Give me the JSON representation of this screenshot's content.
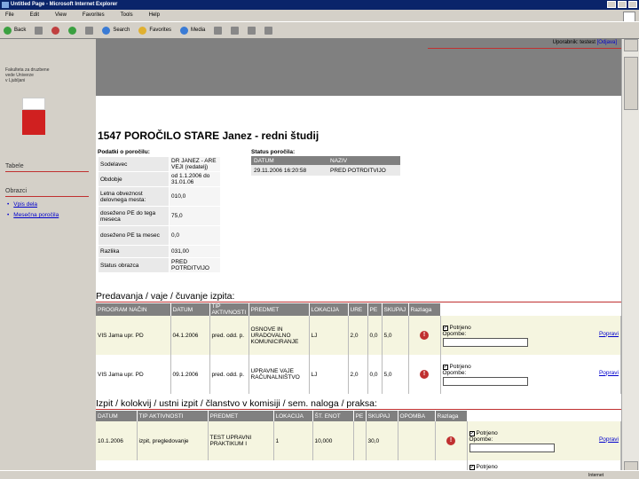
{
  "window": {
    "title": "Untitled Page - Microsoft Internet Explorer"
  },
  "menu": [
    "File",
    "Edit",
    "View",
    "Favorites",
    "Tools",
    "Help"
  ],
  "toolbar": {
    "back": "Back",
    "search": "Search",
    "favorites": "Favorites",
    "media": "Media"
  },
  "user": {
    "text": "Uporabnik: testest",
    "logout": "[Odjava]"
  },
  "sidebar": {
    "org_lines": [
      "Fakulteta za druzbene",
      "vede Univerze",
      "v Ljubljani"
    ],
    "section1": "Tabele",
    "section2": "Obrazci",
    "links": [
      "Vpis dela",
      "Mesečna poročila"
    ]
  },
  "page": {
    "title": "1547 POROČILO STARE Janez - redni študij"
  },
  "podatki": {
    "heading": "Podatki o poročilu:",
    "rows": [
      {
        "label": "Sodelavec",
        "value": "DR JANEZ - ARE VEJI (redatelj)"
      },
      {
        "label": "Obdobje",
        "value": "od 1.1.2006 do 31.01.06"
      },
      {
        "label": "Letna obveznost delovnega mesta:",
        "value": "010,0"
      },
      {
        "label": "doseženo PE do tega meseca",
        "value": "75,0"
      },
      {
        "label": "doseženo PE ta mesec",
        "value": "0,0"
      },
      {
        "label": "Razlika",
        "value": "031,00"
      },
      {
        "label": "Status obrazca",
        "value": "PRED POTRDITVIJO"
      }
    ]
  },
  "status": {
    "heading": "Status poročila:",
    "columns": [
      "DATUM",
      "NAZIV"
    ],
    "rows": [
      [
        "29.11.2006 16:20:58",
        "PRED POTRDITVIJO"
      ]
    ]
  },
  "predavanja": {
    "heading": "Predavanja / vaje / čuvanje izpita:",
    "columns": [
      "PROGRAM NAČIN",
      "DATUM",
      "TIP AKTIVNOSTI",
      "PREDMET",
      "LOKACIJA",
      "URE",
      "PE",
      "SKUPAJ",
      "Razlaga"
    ],
    "rows": [
      {
        "program": "VIS Jama upr. PD",
        "datum": "04.1.2006",
        "tip": "pred. odd. p.",
        "predmet": "OSNOVE IN URADOVALNO KOMUNICIRANJE",
        "lokacija": "LJ",
        "ure": "2,0",
        "pe": "0,0",
        "skupaj": "5,0"
      },
      {
        "program": "VIS Jama upr. PD",
        "datum": "09.1.2006",
        "tip": "pred. odd. p.",
        "predmet": "UPRAVNE VAJE RAČUNALNIŠTVO",
        "lokacija": "LJ",
        "ure": "2,0",
        "pe": "0,0",
        "skupaj": "5,0"
      }
    ],
    "confirm_label": "Potrjeno",
    "note_label": "Opombe:",
    "action_link": "Popravi"
  },
  "izpiti": {
    "heading": "Izpit / kolokvij / ustni izpit / članstvo v komisiji / sem. naloga / praksa:",
    "columns": [
      "DATUM",
      "TIP AKTIVNOSTI",
      "PREDMET",
      "LOKACIJA",
      "ŠT. ENOT",
      "PE",
      "SKUPAJ",
      "OPOMBA",
      "Razlaga"
    ],
    "rows": [
      {
        "datum": "10.1.2006",
        "tip": "izpit, pregledovanje",
        "predmet": "TEST UPRAVNI PRAKTIKUM I",
        "lokacija": "1",
        "st_enot": "10,000",
        "pe": "",
        "skupaj": "30,0",
        "opomba": ""
      }
    ],
    "confirm_label": "Potrjeno",
    "note_label": "Opombe:",
    "action_link": "Popravi"
  },
  "statusbar": {
    "zone": "Internet"
  },
  "colors": {
    "accent_red": "#c03030",
    "header_gray": "#808080",
    "sidebar": "#d4d0c8",
    "title_bar": "#0a246a"
  }
}
